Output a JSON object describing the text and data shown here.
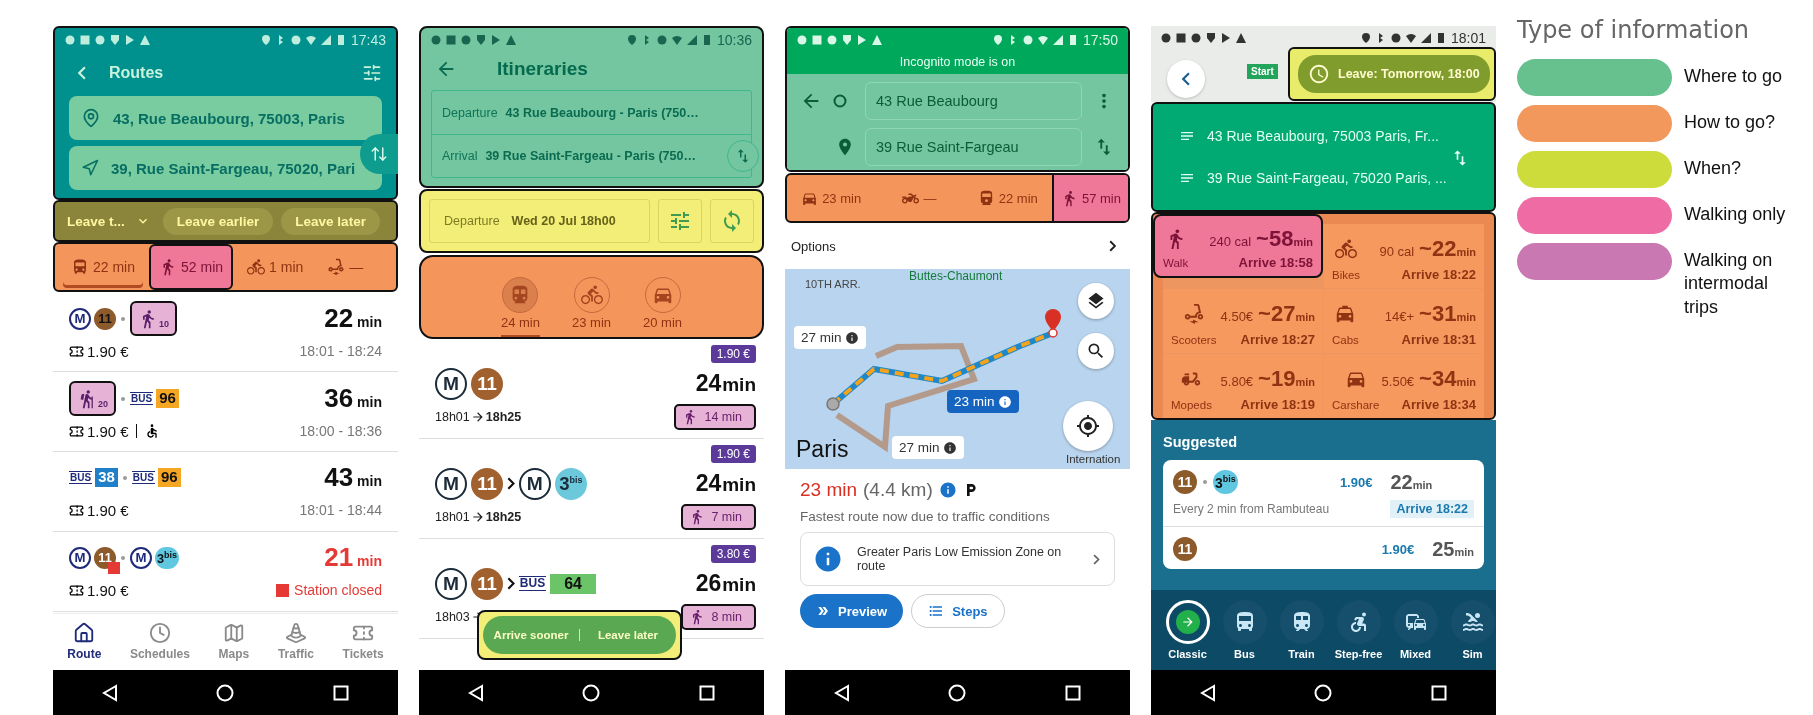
{
  "routes_app": {
    "time": "17:43",
    "title": "Routes",
    "origin": "43, Rue Beaubourg, 75003, Paris",
    "destination": "39, Rue Saint-Fargeau, 75020, Pari",
    "leave_select": "Leave t...",
    "time_buttons": [
      "Leave earlier",
      "Leave later"
    ],
    "modes": [
      {
        "kind": "transit",
        "label": "22 min",
        "selected": true,
        "walking_only": false
      },
      {
        "kind": "walk",
        "label": "52 min",
        "selected": false,
        "walking_only": true
      },
      {
        "kind": "bike",
        "label": "1 min",
        "selected": false,
        "walking_only": false
      },
      {
        "kind": "scooter",
        "label": "—",
        "selected": false,
        "walking_only": false
      }
    ],
    "routes": [
      {
        "legs": [
          {
            "kind": "metro",
            "text": "M"
          },
          {
            "kind": "line",
            "text": "11",
            "color": "#8d5a2b",
            "closed": false
          },
          {
            "kind": "dot"
          },
          {
            "kind": "walk",
            "text": "10"
          }
        ],
        "price": "1.90 €",
        "accessible": false,
        "duration": "22",
        "unit": "min",
        "times": "18:01 - 18:24",
        "closed": false
      },
      {
        "legs": [
          {
            "kind": "hike",
            "text": "20"
          },
          {
            "kind": "dot"
          },
          {
            "kind": "bus",
            "text": "BUS",
            "number": "96",
            "color": "#f5a623"
          }
        ],
        "price": "1.90 €",
        "accessible": true,
        "duration": "36",
        "unit": "min",
        "times": "18:00 - 18:36",
        "closed": false
      },
      {
        "legs": [
          {
            "kind": "bus",
            "text": "BUS",
            "number": "38",
            "color": "#1f7fc8"
          },
          {
            "kind": "dot"
          },
          {
            "kind": "bus",
            "text": "BUS",
            "number": "96",
            "color": "#f5a623"
          }
        ],
        "price": "1.90 €",
        "accessible": false,
        "duration": "43",
        "unit": "min",
        "times": "18:01 - 18:44",
        "closed": false
      },
      {
        "legs": [
          {
            "kind": "metro",
            "text": "M"
          },
          {
            "kind": "line",
            "text": "11",
            "color": "#8d5a2b",
            "closed": true
          },
          {
            "kind": "dot"
          },
          {
            "kind": "metro",
            "text": "M"
          },
          {
            "kind": "line",
            "text": "3$^{bis}$",
            "color": "#5fc8e0",
            "closed": false
          }
        ],
        "price": "1.90 €",
        "accessible": false,
        "duration": "21",
        "unit": "min",
        "alert": "Station closed",
        "closed": true
      }
    ],
    "tabs": [
      {
        "kind": "home",
        "label": "Route",
        "selected": true
      },
      {
        "kind": "clock",
        "label": "Schedules",
        "selected": false
      },
      {
        "kind": "map",
        "label": "Maps",
        "selected": false
      },
      {
        "kind": "cone",
        "label": "Traffic",
        "selected": false
      },
      {
        "kind": "ticket",
        "label": "Tickets",
        "selected": false
      }
    ]
  },
  "itineraries_app": {
    "time": "10:36",
    "title": "Itineraries",
    "places": [
      {
        "label": "Departure",
        "value": "43 Rue Beaubourg - Paris (750…"
      },
      {
        "label": "Arrival",
        "value": "39 Rue Saint-Fargeau - Paris (750…"
      }
    ],
    "when": {
      "label": "Departure",
      "value": "Wed 20 Jul 18h00"
    },
    "modes": [
      {
        "kind": "transit",
        "label": "24 min",
        "selected": true
      },
      {
        "kind": "bike",
        "label": "23 min",
        "selected": false
      },
      {
        "kind": "car",
        "label": "20 min",
        "selected": false
      }
    ],
    "results": [
      {
        "price": "1.90 €",
        "legs": [
          {
            "kind": "metro",
            "text": "M"
          },
          {
            "kind": "line",
            "text": "11",
            "color": "#a0612f"
          }
        ],
        "duration": "24",
        "unit": "min",
        "walk": "14 min",
        "depart": "18h01",
        "arrive": "18h25"
      },
      {
        "price": "1.90 €",
        "legs": [
          {
            "kind": "metro",
            "text": "M"
          },
          {
            "kind": "line",
            "text": "11",
            "color": "#a0612f"
          },
          {
            "kind": "chevron"
          },
          {
            "kind": "metro",
            "text": "M"
          },
          {
            "kind": "line",
            "text": "3$^{bis}$",
            "color": "#6cc9dc"
          }
        ],
        "duration": "24",
        "unit": "min",
        "walk": "7 min",
        "depart": "18h01",
        "arrive": "18h25"
      },
      {
        "price": "3.80 €",
        "legs": [
          {
            "kind": "metro",
            "text": "M"
          },
          {
            "kind": "line",
            "text": "11",
            "color": "#a0612f"
          },
          {
            "kind": "chevron"
          },
          {
            "kind": "bus",
            "text": "BUS",
            "number": "64",
            "color": "#6cc468"
          }
        ],
        "duration": "26",
        "unit": "min",
        "walk": "8 min",
        "depart": "18h03"
      }
    ],
    "float_actions": [
      "Arrive sooner",
      "Leave later"
    ]
  },
  "maps_app": {
    "time": "17:50",
    "banner": "Incognito mode is on",
    "origin": "43 Rue Beaubourg",
    "destination": "39 Rue Saint-Fargeau",
    "modes": [
      {
        "kind": "car",
        "label": "23 min",
        "walking_only": false
      },
      {
        "kind": "motorbike",
        "label": "—",
        "walking_only": false
      },
      {
        "kind": "train",
        "label": "22 min",
        "walking_only": false
      },
      {
        "kind": "walk",
        "label": "57 min",
        "walking_only": true
      }
    ],
    "options": "Options",
    "area_labels": [
      "10TH ARR.",
      "Buttes-Chaumont",
      "Paris",
      "Internation"
    ],
    "route_labels": [
      {
        "text": "27 min",
        "selected": false
      },
      {
        "text": "23 min",
        "selected": true
      },
      {
        "text": "27 min",
        "selected": false
      }
    ],
    "duration": "23 min",
    "distance": "(4.4 km)",
    "summary": "Fastest route now due to traffic conditions",
    "notice": "Greater Paris Low Emission Zone on route",
    "actions": [
      {
        "kind": "primary",
        "label": "Preview"
      },
      {
        "kind": "secondary",
        "label": "Steps"
      }
    ]
  },
  "transit_app": {
    "time": "18:01",
    "start_marker": "Start",
    "leave": "Leave: Tomorrow, 18:00",
    "origin": "43 Rue Beaubourg, 75003 Paris, Fr...",
    "destination": "39 Rue Saint-Fargeau, 75020 Paris, ...",
    "options": [
      {
        "kind": "walk",
        "name": "Walk",
        "cost": "240 cal",
        "duration": "~58",
        "unit": "min",
        "arrive": "Arrive 18:58",
        "walking_only": true
      },
      {
        "kind": "bike",
        "name": "Bikes",
        "cost": "90 cal",
        "duration": "~22",
        "unit": "min",
        "arrive": "Arrive 18:22",
        "walking_only": false
      },
      {
        "kind": "scooter",
        "name": "Scooters",
        "cost": "4.50€",
        "duration": "~27",
        "unit": "min",
        "arrive": "Arrive 18:27",
        "walking_only": false
      },
      {
        "kind": "cab",
        "name": "Cabs",
        "cost": "14€+",
        "duration": "~31",
        "unit": "min",
        "arrive": "Arrive 18:31",
        "walking_only": false
      },
      {
        "kind": "moped",
        "name": "Mopeds",
        "cost": "5.80€",
        "duration": "~19",
        "unit": "min",
        "arrive": "Arrive 18:19",
        "walking_only": false
      },
      {
        "kind": "car",
        "name": "Carshare",
        "cost": "5.50€",
        "duration": "~34",
        "unit": "min",
        "arrive": "Arrive 18:34",
        "walking_only": false
      }
    ],
    "section": "Suggested",
    "suggestions": [
      {
        "legs": [
          {
            "text": "11",
            "color": "#8d5a2b"
          },
          {
            "text": "3$^{bis}$",
            "color": "#5fc8e0"
          }
        ],
        "price": "1.90€",
        "duration": "22",
        "unit": "min",
        "frequency": "Every 2 min from Rambuteau",
        "arrive": "Arrive 18:22"
      },
      {
        "legs": [
          {
            "text": "11",
            "color": "#8d5a2b"
          }
        ],
        "price": "1.90€",
        "duration": "25",
        "unit": "min"
      }
    ],
    "modes": [
      {
        "kind": "classic",
        "label": "Classic",
        "selected": true
      },
      {
        "kind": "bus",
        "label": "Bus",
        "selected": false
      },
      {
        "kind": "train",
        "label": "Train",
        "selected": false
      },
      {
        "kind": "stepfree",
        "label": "Step-free",
        "selected": false
      },
      {
        "kind": "mixed",
        "label": "Mixed",
        "selected": false
      },
      {
        "kind": "other",
        "label": "Sim",
        "selected": false
      }
    ]
  },
  "legend": {
    "title": "Type of information",
    "items": [
      {
        "label": "Where to go",
        "color": "#66c18f"
      },
      {
        "label": "How to go?",
        "color": "#f2985c"
      },
      {
        "label": "When?",
        "color": "#cddc3a"
      },
      {
        "label": "Walking only",
        "color": "#ef6ba4"
      },
      {
        "label": "Walking on intermodal trips",
        "color": "#c978b1"
      }
    ]
  }
}
